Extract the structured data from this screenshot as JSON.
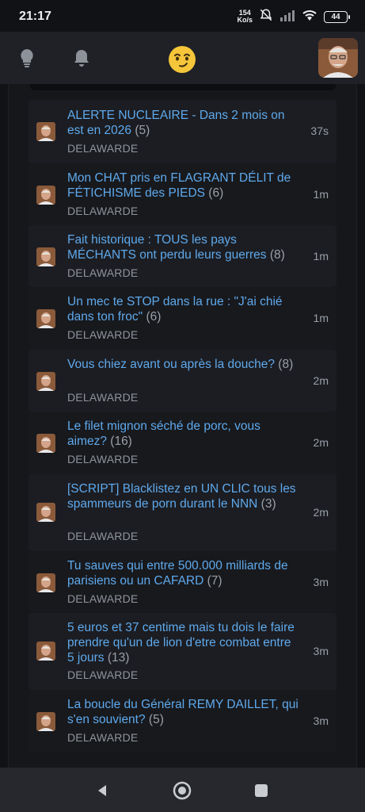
{
  "status": {
    "time": "21:17",
    "net_speed_value": "154",
    "net_speed_unit": "Ko/s",
    "battery": "44"
  },
  "header": {
    "icons": [
      "lightbulb-icon",
      "bell-icon",
      "emoji-face-icon",
      "user-avatar"
    ]
  },
  "topics": [
    {
      "title": "ALERTE NUCLEAIRE - Dans 2 mois on est en 2026",
      "count": "(5)",
      "author": "DELAWARDE",
      "time": "37s"
    },
    {
      "title": "Mon CHAT pris en FLAGRANT DÉLIT de FÉTICHISME des PIEDS",
      "count": "(6)",
      "author": "DELAWARDE",
      "time": "1m"
    },
    {
      "title": "Fait historique : TOUS les pays MÉCHANTS ont perdu leurs guerres",
      "count": "(8)",
      "author": "DELAWARDE",
      "time": "1m"
    },
    {
      "title": "Un mec te STOP dans la rue : \"J'ai chié dans ton froc\"",
      "count": "(6)",
      "author": "DELAWARDE",
      "time": "1m"
    },
    {
      "title": "Vous chiez avant ou après la douche?",
      "count": "(8)",
      "author": "DELAWARDE",
      "time": "2m"
    },
    {
      "title": "Le filet mignon séché de porc, vous aimez?",
      "count": "(16)",
      "author": "DELAWARDE",
      "time": "2m"
    },
    {
      "title": "[SCRIPT] Blacklistez en UN CLIC tous les spammeurs de porn durant le NNN",
      "count": "(3)",
      "author": "DELAWARDE",
      "time": "2m"
    },
    {
      "title": "Tu sauves qui entre 500.000 milliards de parisiens ou un CAFARD",
      "count": "(7)",
      "author": "DELAWARDE",
      "time": "3m"
    },
    {
      "title": "5 euros et 37 centime mais tu dois le faire prendre qu'un de lion d'etre combat entre 5 jours",
      "count": "(13)",
      "author": "DELAWARDE",
      "time": "3m"
    },
    {
      "title": "La boucle du Général REMY DAILLET, qui s'en souvient?",
      "count": "(5)",
      "author": "DELAWARDE",
      "time": "3m"
    }
  ],
  "nav": {
    "icons": [
      "back-icon",
      "home-icon",
      "recents-icon"
    ]
  }
}
